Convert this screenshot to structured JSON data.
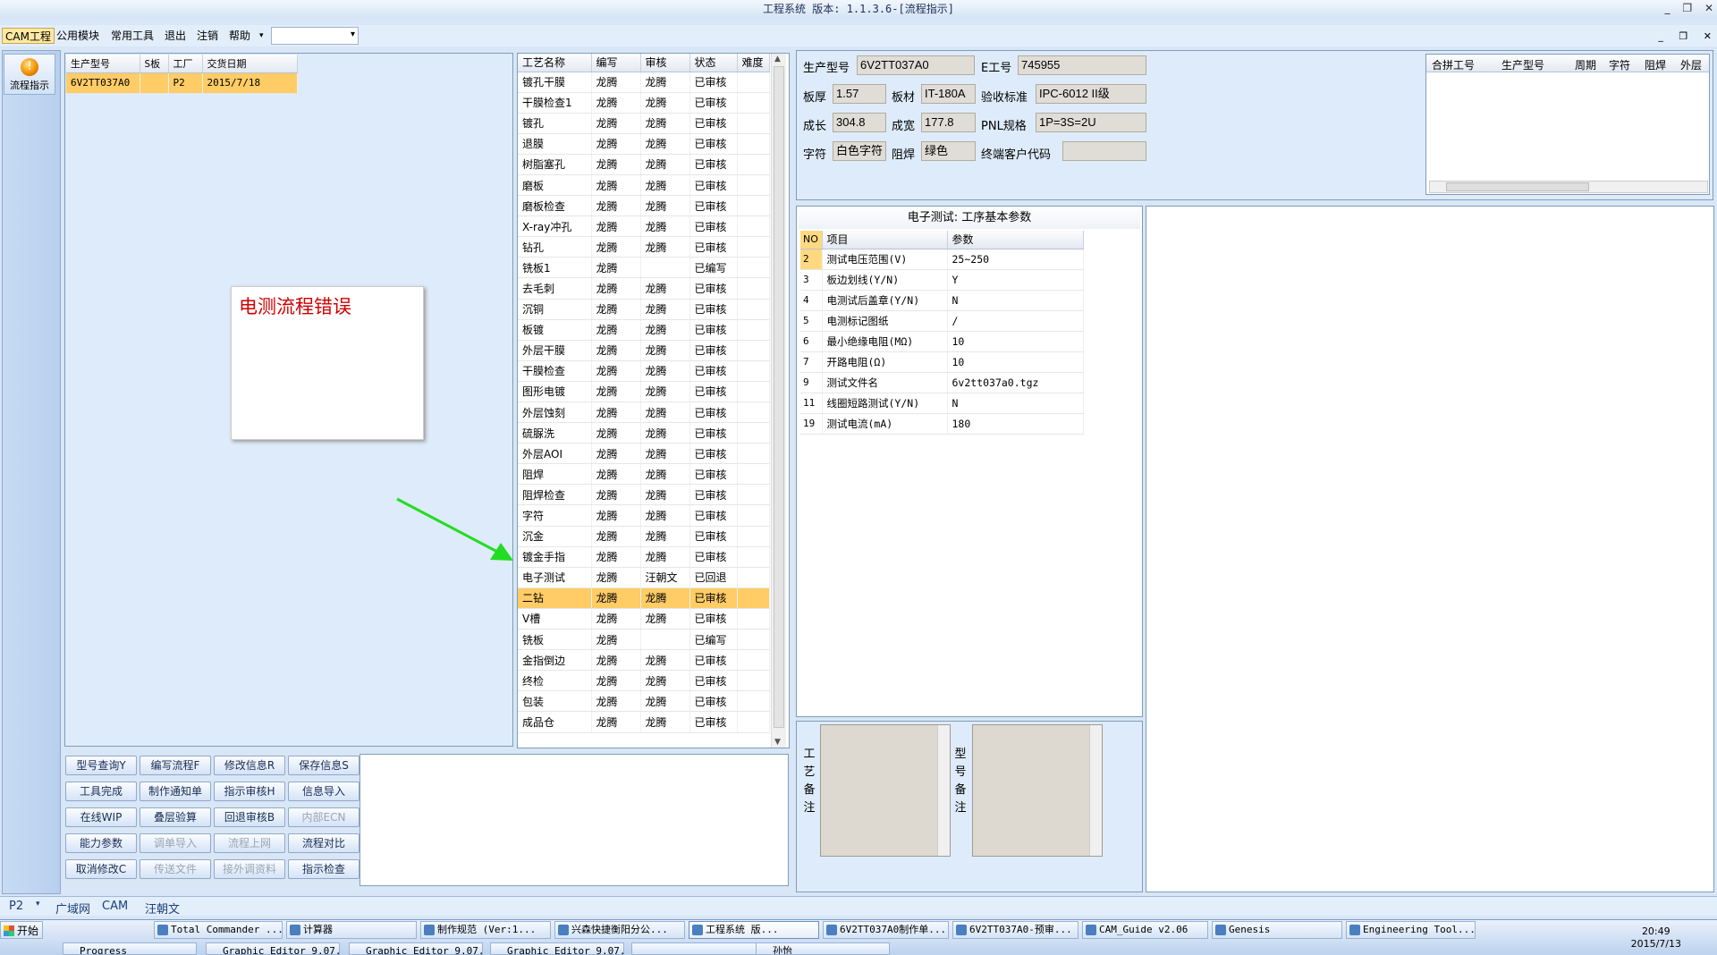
{
  "window": {
    "title": "工程系统 版本: 1.1.3.6-[流程指示]",
    "controls": [
      "_",
      "❐",
      "✕"
    ]
  },
  "menu": {
    "items": [
      "CAM工程",
      "公用模块",
      "常用工具",
      "退出",
      "注销",
      "帮助"
    ],
    "combo_value": ""
  },
  "mdi_controls": [
    "_",
    "❐",
    "✕"
  ],
  "left_toolbar": {
    "flow_button_label": "流程指示"
  },
  "jobs": {
    "columns": [
      "生产型号",
      "S板",
      "工厂",
      "交货日期"
    ],
    "rows": [
      [
        "6V2TT037A0",
        "",
        "P2",
        "2015/7/18"
      ]
    ]
  },
  "sticky_note": {
    "text": "电测流程错误"
  },
  "process": {
    "columns": [
      "工艺名称",
      "编写",
      "审核",
      "状态",
      "难度"
    ],
    "selected_index": 25,
    "rows": [
      [
        "镀孔干膜",
        "龙腾",
        "龙腾",
        "已审核",
        ""
      ],
      [
        "干膜检查1",
        "龙腾",
        "龙腾",
        "已审核",
        ""
      ],
      [
        "镀孔",
        "龙腾",
        "龙腾",
        "已审核",
        ""
      ],
      [
        "退膜",
        "龙腾",
        "龙腾",
        "已审核",
        ""
      ],
      [
        "树脂塞孔",
        "龙腾",
        "龙腾",
        "已审核",
        ""
      ],
      [
        "磨板",
        "龙腾",
        "龙腾",
        "已审核",
        ""
      ],
      [
        "磨板检查",
        "龙腾",
        "龙腾",
        "已审核",
        ""
      ],
      [
        "X-ray冲孔",
        "龙腾",
        "龙腾",
        "已审核",
        ""
      ],
      [
        "钻孔",
        "龙腾",
        "龙腾",
        "已审核",
        ""
      ],
      [
        "铣板1",
        "龙腾",
        "",
        "已编写",
        ""
      ],
      [
        "去毛刺",
        "龙腾",
        "龙腾",
        "已审核",
        ""
      ],
      [
        "沉铜",
        "龙腾",
        "龙腾",
        "已审核",
        ""
      ],
      [
        "板镀",
        "龙腾",
        "龙腾",
        "已审核",
        ""
      ],
      [
        "外层干膜",
        "龙腾",
        "龙腾",
        "已审核",
        ""
      ],
      [
        "干膜检查",
        "龙腾",
        "龙腾",
        "已审核",
        ""
      ],
      [
        "图形电镀",
        "龙腾",
        "龙腾",
        "已审核",
        ""
      ],
      [
        "外层蚀刻",
        "龙腾",
        "龙腾",
        "已审核",
        ""
      ],
      [
        "硫脲洗",
        "龙腾",
        "龙腾",
        "已审核",
        ""
      ],
      [
        "外层AOI",
        "龙腾",
        "龙腾",
        "已审核",
        ""
      ],
      [
        "阻焊",
        "龙腾",
        "龙腾",
        "已审核",
        ""
      ],
      [
        "阻焊检查",
        "龙腾",
        "龙腾",
        "已审核",
        ""
      ],
      [
        "字符",
        "龙腾",
        "龙腾",
        "已审核",
        ""
      ],
      [
        "沉金",
        "龙腾",
        "龙腾",
        "已审核",
        ""
      ],
      [
        "镀金手指",
        "龙腾",
        "龙腾",
        "已审核",
        ""
      ],
      [
        "电子测试",
        "龙腾",
        "汪朝文",
        "已回退",
        ""
      ],
      [
        "二钻",
        "龙腾",
        "龙腾",
        "已审核",
        ""
      ],
      [
        "V槽",
        "龙腾",
        "龙腾",
        "已审核",
        ""
      ],
      [
        "铣板",
        "龙腾",
        "",
        "已编写",
        ""
      ],
      [
        "金指倒边",
        "龙腾",
        "龙腾",
        "已审核",
        ""
      ],
      [
        "终检",
        "龙腾",
        "龙腾",
        "已审核",
        ""
      ],
      [
        "包装",
        "龙腾",
        "龙腾",
        "已审核",
        ""
      ],
      [
        "成品仓",
        "龙腾",
        "龙腾",
        "已审核",
        ""
      ]
    ]
  },
  "buttons": {
    "b1": "型号查询Y",
    "b2": "编写流程F",
    "b3": "修改信息R",
    "b4": "保存信息S",
    "b5": "工具完成",
    "b6": "制作通知单",
    "b7": "指示审核H",
    "b8": "信息导入",
    "b9": "在线WIP",
    "b10": "叠层验算",
    "b11": "回退审核B",
    "b12": "内部ECN",
    "b13": "能力参数",
    "b14": "调单导入",
    "b15": "流程上网",
    "b16": "流程对比",
    "b17": "取消修改C",
    "b18": "传送文件",
    "b19": "接外调资料",
    "b20": "指示检查"
  },
  "info": {
    "model_label": "生产型号",
    "model_value": "6V2TT037A0",
    "eno_label": "E工号",
    "eno_value": "745955",
    "thick_label": "板厚",
    "thick_value": "1.57",
    "material_label": "板材",
    "material_value": "IT-180A",
    "std_label": "验收标准",
    "std_value": "IPC-6012 II级",
    "len_label": "成长",
    "len_value": "304.8",
    "wid_label": "成宽",
    "wid_value": "177.8",
    "pnl_label": "PNL规格",
    "pnl_value": "1P=3S=2U",
    "char_label": "字符",
    "char_value": "白色字符",
    "mask_label": "阻焊",
    "mask_value": "绿色",
    "cust_label": "终端客户代码",
    "cust_value": ""
  },
  "merge": {
    "columns": [
      "合拼工号",
      "生产型号",
      "周期",
      "字符",
      "阻焊",
      "外层"
    ]
  },
  "params": {
    "title": "电子测试: 工序基本参数",
    "columns": [
      "NO",
      "项目",
      "参数"
    ],
    "rows": [
      [
        "2",
        "测试电压范围(V)",
        "25~250"
      ],
      [
        "3",
        "板边划线(Y/N)",
        "Y"
      ],
      [
        "4",
        "电测试后盖章(Y/N)",
        "N"
      ],
      [
        "5",
        "电测标记图纸",
        "/"
      ],
      [
        "6",
        "最小绝缘电阻(MΩ)",
        "10"
      ],
      [
        "7",
        "开路电阻(Ω)",
        "10"
      ],
      [
        "9",
        "测试文件名",
        "6v2tt037a0.tgz"
      ],
      [
        "11",
        "线圈短路测试(Y/N)",
        "N"
      ],
      [
        "19",
        "测试电流(mA)",
        "180"
      ]
    ]
  },
  "remarks": {
    "craft_label": "工艺备注",
    "model_label": "型号备注"
  },
  "status": {
    "factory": "P2",
    "net": "广域网",
    "module": "CAM",
    "user": "汪朝文"
  },
  "taskbar": {
    "start": "开始",
    "row1": [
      "Total Commander ...",
      "计算器",
      "制作规范 (Ver:1...",
      "兴森快捷衡阳分公...",
      "工程系统 版...",
      "6V2TT037A0制作单...",
      "6V2TT037A0-预审...",
      "CAM_Guide v2.06",
      "Genesis",
      "Engineering Tool..."
    ],
    "row2": [
      "Progress",
      "Graphic Editor 9.07...",
      "Graphic Editor 9.07...",
      "Graphic Editor 9.07...",
      "",
      "孙怡"
    ],
    "clock_time": "20:49",
    "clock_date": "2015/7/13"
  },
  "colors": {
    "selected_row": "#ffcc66",
    "note_text": "#d00000",
    "arrow": "#22dd22"
  }
}
